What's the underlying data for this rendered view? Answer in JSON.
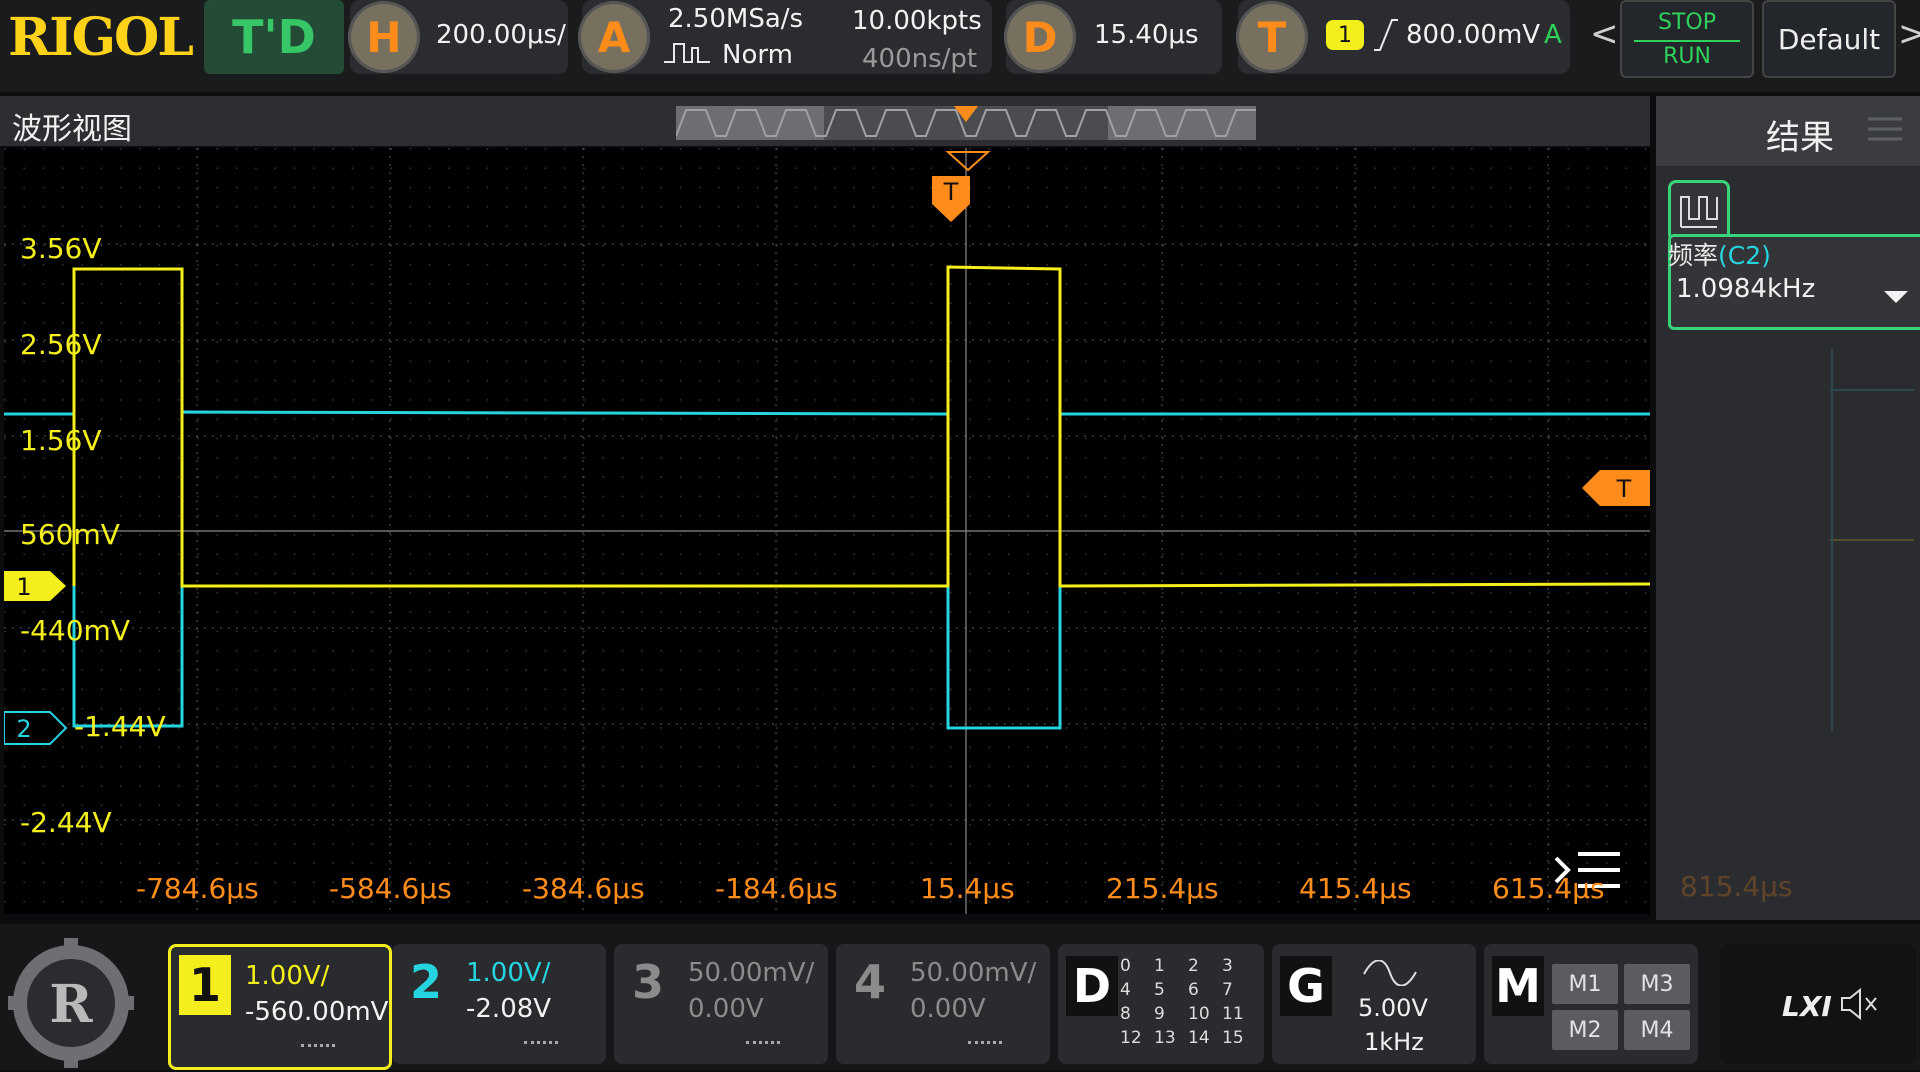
{
  "topbar": {
    "logo": "RIGOL",
    "mode": "T'D",
    "horizontal": {
      "icon": "H",
      "scale": "200.00μs/"
    },
    "acquire": {
      "icon": "A",
      "sample_rate": "2.50MSa/s",
      "mode": "Norm",
      "memory": "10.00kpts",
      "resolution": "400ns/pt"
    },
    "delay": {
      "icon": "D",
      "value": "15.40μs"
    },
    "trigger": {
      "icon": "T",
      "source": "1",
      "level": "800.00mV",
      "sweep": "A"
    },
    "nav_prev": "<",
    "nav_next": ">",
    "stop_label": "STOP",
    "run_label": "RUN",
    "default_label": "Default"
  },
  "waveform_view": {
    "title": "波形视图",
    "trigger_marker": "T",
    "trigger_level_marker": "T",
    "y_labels": [
      "3.56V",
      "2.56V",
      "1.56V",
      "560mV",
      "-440mV",
      "-1.44V",
      "-2.44V"
    ],
    "x_labels": [
      "-784.6μs",
      "-584.6μs",
      "-384.6μs",
      "-184.6μs",
      "15.4μs",
      "215.4μs",
      "415.4μs",
      "615.4μs",
      "815.4μs"
    ],
    "ch1_marker": "1",
    "ch2_marker": "2",
    "colors": {
      "ch1": "#f4ef1c",
      "ch2": "#26d4e0",
      "trigger": "#ff8c1a"
    }
  },
  "results": {
    "title": "结果",
    "measure_label": "频率",
    "measure_source": "(C2)",
    "measure_value": "1.0984kHz"
  },
  "bottombar": {
    "ch1": {
      "num": "1",
      "scale": "1.00V/",
      "offset": "-560.00mV"
    },
    "ch2": {
      "num": "2",
      "scale": "1.00V/",
      "offset": "-2.08V"
    },
    "ch3": {
      "num": "3",
      "scale": "50.00mV/",
      "offset": "0.00V"
    },
    "ch4": {
      "num": "4",
      "scale": "50.00mV/",
      "offset": "0.00V"
    },
    "digital": {
      "label": "D",
      "channels": [
        "0",
        "1",
        "2",
        "3",
        "4",
        "5",
        "6",
        "7",
        "8",
        "9",
        "10",
        "11",
        "12",
        "13",
        "14",
        "15"
      ]
    },
    "generator": {
      "label": "G",
      "amplitude": "5.00V",
      "frequency": "1kHz"
    },
    "math": {
      "label": "M",
      "items": [
        "M1",
        "M3",
        "M2",
        "M4"
      ]
    },
    "lxi": "LXI"
  }
}
